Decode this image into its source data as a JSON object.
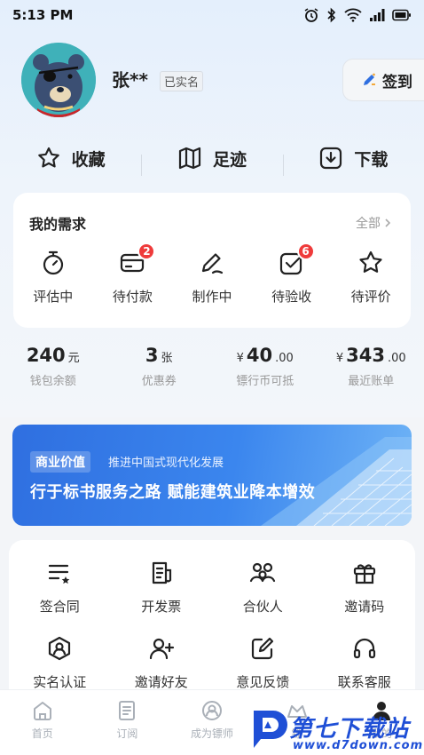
{
  "status_bar": {
    "time": "5:13 PM"
  },
  "profile": {
    "name": "张**",
    "verified": "已实名",
    "checkin_label": "签到"
  },
  "quick_links": [
    {
      "label": "收藏",
      "icon": "star-icon"
    },
    {
      "label": "足迹",
      "icon": "map-icon"
    },
    {
      "label": "下载",
      "icon": "download-icon"
    }
  ],
  "demand": {
    "title": "我的需求",
    "more": "全部",
    "items": [
      {
        "label": "评估中",
        "icon": "stopwatch-icon",
        "badge": ""
      },
      {
        "label": "待付款",
        "icon": "card-icon",
        "badge": "2"
      },
      {
        "label": "制作中",
        "icon": "pencil-icon",
        "badge": ""
      },
      {
        "label": "待验收",
        "icon": "check-square-icon",
        "badge": "6"
      },
      {
        "label": "待评价",
        "icon": "star-outline-icon",
        "badge": ""
      }
    ]
  },
  "wallet": [
    {
      "prefix": "",
      "value": "240",
      "suffix": "元",
      "label": "钱包余额"
    },
    {
      "prefix": "",
      "value": "3",
      "suffix": "张",
      "label": "优惠券"
    },
    {
      "prefix": "¥",
      "value": "40",
      "suffix": ".00",
      "label": "镖行币可抵"
    },
    {
      "prefix": "¥",
      "value": "343",
      "suffix": ".00",
      "label": "最近账单"
    }
  ],
  "banner": {
    "tag": "商业价值",
    "sub": "推进中国式现代化发展",
    "title": "行于标书服务之路  赋能建筑业降本增效"
  },
  "services": [
    {
      "label": "签合同",
      "icon": "contract-icon"
    },
    {
      "label": "开发票",
      "icon": "invoice-icon"
    },
    {
      "label": "合伙人",
      "icon": "partners-icon"
    },
    {
      "label": "邀请码",
      "icon": "gift-icon"
    },
    {
      "label": "实名认证",
      "icon": "id-verify-icon"
    },
    {
      "label": "邀请好友",
      "icon": "add-user-icon"
    },
    {
      "label": "意见反馈",
      "icon": "feedback-icon"
    },
    {
      "label": "联系客服",
      "icon": "headset-icon"
    }
  ],
  "tabbar": [
    {
      "label": "首页",
      "icon": "home-icon"
    },
    {
      "label": "订阅",
      "icon": "subscribe-icon"
    },
    {
      "label": "成为镖师",
      "icon": "escort-icon"
    },
    {
      "label": "镖",
      "icon": "escort-hall-icon"
    },
    {
      "label": "我的",
      "icon": "profile-icon"
    }
  ],
  "watermark": {
    "text": "第七下载站",
    "url": "www.d7down.com"
  },
  "colors": {
    "accent": "#2f6fe0",
    "badge": "#ef3b3b",
    "page_bg": "#f3f5f8"
  }
}
